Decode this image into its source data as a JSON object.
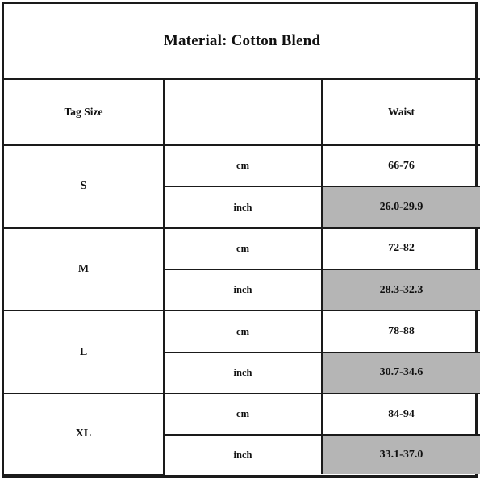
{
  "chart": {
    "title": "Material:  Cotton Blend",
    "headers": {
      "tag_size": "Tag Size",
      "unit": "",
      "waist": "Waist"
    },
    "units": {
      "cm": "cm",
      "inch": "inch"
    },
    "colors": {
      "shaded_cell": "#b5b5b5",
      "border": "#1a1a1a",
      "background": "#ffffff",
      "text": "#111111"
    },
    "rows": [
      {
        "size": "S",
        "cm_label": "cm",
        "cm_waist": "66-76",
        "inch_label": "inch",
        "inch_waist": "26.0-29.9"
      },
      {
        "size": "M",
        "cm_label": "cm",
        "cm_waist": "72-82",
        "inch_label": "inch",
        "inch_waist": "28.3-32.3"
      },
      {
        "size": "L",
        "cm_label": "cm",
        "cm_waist": "78-88",
        "inch_label": "inch",
        "inch_waist": "30.7-34.6"
      },
      {
        "size": "XL",
        "cm_label": "cm",
        "cm_waist": "84-94",
        "inch_label": "inch",
        "inch_waist": "33.1-37.0"
      }
    ]
  }
}
